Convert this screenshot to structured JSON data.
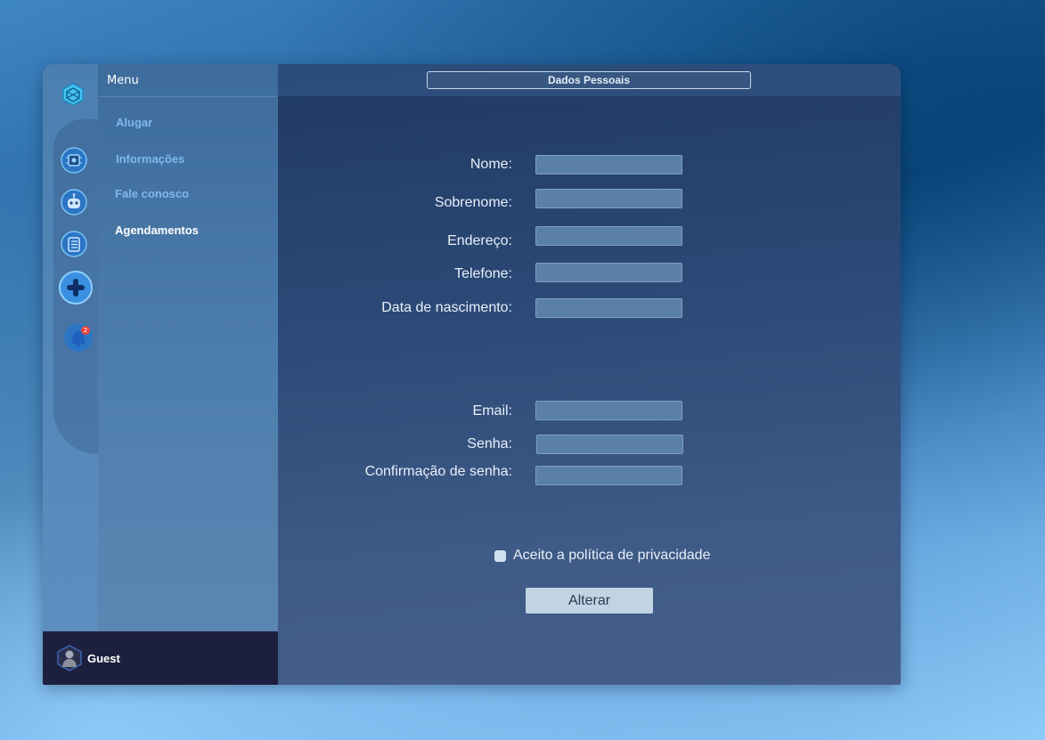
{
  "menu": {
    "title": "Menu",
    "items": [
      {
        "label": "Alugar"
      },
      {
        "label": "Informações"
      },
      {
        "label": "Fale conosco"
      },
      {
        "label": "Agendamentos"
      }
    ]
  },
  "header": {
    "title": "Dados Pessoais"
  },
  "form": {
    "nome": {
      "label": "Nome:",
      "value": ""
    },
    "sobrenome": {
      "label": "Sobrenome:",
      "value": ""
    },
    "endereco": {
      "label": "Endereço:",
      "value": ""
    },
    "telefone": {
      "label": "Telefone:",
      "value": ""
    },
    "nascimento": {
      "label": "Data de nascimento:",
      "value": ""
    },
    "email": {
      "label": "Email:",
      "value": ""
    },
    "senha": {
      "label": "Senha:",
      "value": ""
    },
    "confirmacao": {
      "label": "Confirmação de senha:",
      "value": ""
    },
    "privacy_label": "Aceito a política de privacidade",
    "submit_label": "Alterar"
  },
  "notifications": {
    "count": "2"
  },
  "user": {
    "name": "Guest"
  },
  "icons": [
    "logo-icon",
    "chip-icon",
    "robot-icon",
    "list-icon",
    "add-icon",
    "bell-icon"
  ],
  "colors": {
    "accent": "#7fb8ee",
    "user_bar": "#1d1f3e",
    "button": "#c2d3e4"
  }
}
